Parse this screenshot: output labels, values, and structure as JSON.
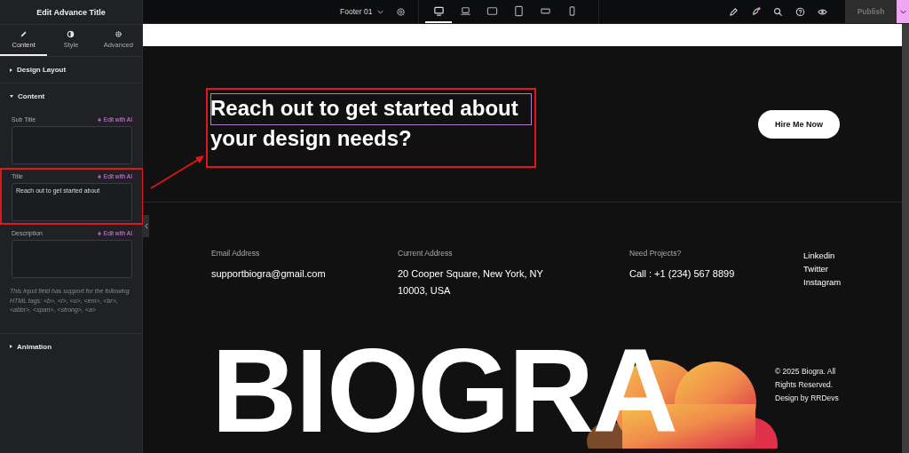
{
  "panel": {
    "title": "Edit Advance Title",
    "tabs": [
      {
        "label": "Content",
        "kind": "pencil",
        "selected": true
      },
      {
        "label": "Style",
        "kind": "contrast",
        "selected": false
      },
      {
        "label": "Advanced",
        "kind": "gear",
        "selected": false
      }
    ],
    "sections": [
      {
        "label": "Design Layout",
        "expanded": false
      },
      {
        "label": "Content",
        "expanded": true,
        "fields": [
          {
            "label": "Sub Title",
            "ai_label": "Edit with AI",
            "highlighted": false
          },
          {
            "label": "Title",
            "ai_label": "Edit with AI",
            "value": "Reach out to get started about",
            "highlighted": true
          },
          {
            "label": "Description",
            "ai_label": "Edit with AI",
            "highlighted": false
          }
        ],
        "help": "This input field has support for the following HTML tags: <b>, <i>, <u>, <em>, <br>, <abbr>, <span>, <strong>, <a>"
      },
      {
        "label": "Animation",
        "expanded": false
      }
    ]
  },
  "topbar": {
    "template": "Footer 01",
    "devices": [
      {
        "kind": "desktop",
        "selected": true
      },
      {
        "kind": "laptop",
        "selected": false
      },
      {
        "kind": "tablet-landscape",
        "selected": false
      },
      {
        "kind": "tablet",
        "selected": false
      },
      {
        "kind": "mobile-landscape",
        "selected": false
      },
      {
        "kind": "mobile",
        "selected": false
      }
    ],
    "publish": {
      "label": "Publish",
      "disabled": true
    }
  },
  "canvas": {
    "heading": "Reach out to get started about your design needs?",
    "heading_highlighted": true,
    "button": "Hire Me Now",
    "contacts": [
      {
        "label": "Email Address",
        "value": "supportbiogra@gmail.com"
      },
      {
        "label": "Current Address",
        "value": "20 Cooper Square, New York, NY 10003, USA"
      },
      {
        "label": "Need Projects?",
        "value": "Call : +1 (234) 567 8899"
      }
    ],
    "social": [
      "Linkedin",
      "Twitter",
      "Instagram"
    ],
    "logo": "BIOGRA",
    "copyright": "© 2025 Biogra. All Rights Reserved. Design by RRDevs"
  }
}
